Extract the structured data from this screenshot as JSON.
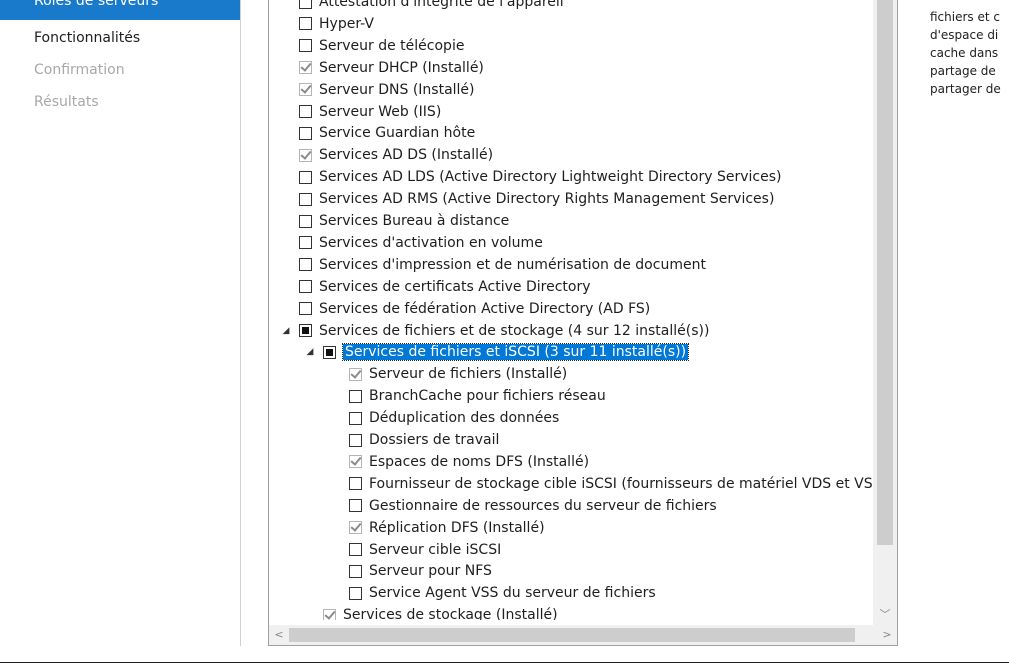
{
  "nav": {
    "active": "Rôles de serveurs",
    "items": [
      {
        "label": "Fonctionnalités",
        "enabled": true
      },
      {
        "label": "Confirmation",
        "enabled": false
      },
      {
        "label": "Résultats",
        "enabled": false
      }
    ]
  },
  "tree": {
    "rows": [
      {
        "label": "Attestation d'intégrité de l'appareil",
        "state": "unchecked",
        "level": 0
      },
      {
        "label": "Hyper-V",
        "state": "unchecked",
        "level": 0
      },
      {
        "label": "Serveur de télécopie",
        "state": "unchecked",
        "level": 0
      },
      {
        "label": "Serveur DHCP (Installé)",
        "state": "checked",
        "level": 0
      },
      {
        "label": "Serveur DNS (Installé)",
        "state": "checked",
        "level": 0
      },
      {
        "label": "Serveur Web (IIS)",
        "state": "unchecked",
        "level": 0
      },
      {
        "label": "Service Guardian hôte",
        "state": "unchecked",
        "level": 0
      },
      {
        "label": "Services AD DS (Installé)",
        "state": "checked",
        "level": 0
      },
      {
        "label": "Services AD LDS (Active Directory Lightweight Directory Services)",
        "state": "unchecked",
        "level": 0
      },
      {
        "label": "Services AD RMS (Active Directory Rights Management Services)",
        "state": "unchecked",
        "level": 0
      },
      {
        "label": "Services Bureau à distance",
        "state": "unchecked",
        "level": 0
      },
      {
        "label": "Services d'activation en volume",
        "state": "unchecked",
        "level": 0
      },
      {
        "label": "Services d'impression et de numérisation de document",
        "state": "unchecked",
        "level": 0
      },
      {
        "label": "Services de certificats Active Directory",
        "state": "unchecked",
        "level": 0
      },
      {
        "label": "Services de fédération Active Directory (AD FS)",
        "state": "unchecked",
        "level": 0
      },
      {
        "label": "Services de fichiers et de stockage (4 sur 12 installé(s))",
        "state": "partial",
        "level": 0,
        "expander": "◢"
      },
      {
        "label": "Services de fichiers et iSCSI (3 sur 11 installé(s))",
        "state": "partial",
        "level": 1,
        "expander": "◢",
        "selected": true
      },
      {
        "label": "Serveur de fichiers (Installé)",
        "state": "checked",
        "level": 2
      },
      {
        "label": "BranchCache pour fichiers réseau",
        "state": "unchecked",
        "level": 2
      },
      {
        "label": "Déduplication des données",
        "state": "unchecked",
        "level": 2
      },
      {
        "label": "Dossiers de travail",
        "state": "unchecked",
        "level": 2
      },
      {
        "label": "Espaces de noms DFS (Installé)",
        "state": "checked",
        "level": 2
      },
      {
        "label": "Fournisseur de stockage cible iSCSI (fournisseurs de matériel VDS et VS",
        "state": "unchecked",
        "level": 2
      },
      {
        "label": "Gestionnaire de ressources du serveur de fichiers",
        "state": "unchecked",
        "level": 2
      },
      {
        "label": "Réplication DFS (Installé)",
        "state": "checked",
        "level": 2
      },
      {
        "label": "Serveur cible iSCSI",
        "state": "unchecked",
        "level": 2
      },
      {
        "label": "Serveur pour NFS",
        "state": "unchecked",
        "level": 2
      },
      {
        "label": "Service Agent VSS du serveur de fichiers",
        "state": "unchecked",
        "level": 2
      },
      {
        "label": "Services de stockage (Installé)",
        "state": "checked",
        "level": 1
      }
    ]
  },
  "description": {
    "lines": [
      "fichiers et c",
      "d'espace di",
      "cache dans",
      "partage de",
      "partager de"
    ]
  },
  "scroll": {
    "down_glyph": "﹀",
    "left_glyph": "<",
    "right_glyph": ">"
  }
}
